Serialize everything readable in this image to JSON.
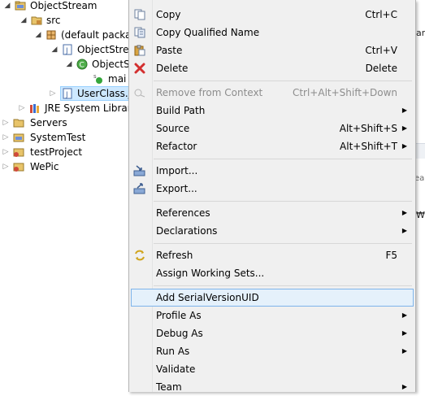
{
  "tree": {
    "nodes": [
      {
        "label": "ObjectStream",
        "icon": "project-icon"
      },
      {
        "label": "src",
        "icon": "source-folder-icon"
      },
      {
        "label": "(default packag",
        "icon": "package-icon"
      },
      {
        "label": "ObjectStrea",
        "icon": "java-file-icon"
      },
      {
        "label": "ObjectS",
        "icon": "class-icon"
      },
      {
        "label": "mai",
        "icon": "method-icon"
      },
      {
        "label": "UserClass.ja",
        "icon": "java-file-icon"
      },
      {
        "label": "JRE System Library",
        "icon": "library-icon"
      },
      {
        "label": "Servers",
        "icon": "folder-icon"
      },
      {
        "label": "SystemTest",
        "icon": "project-icon"
      },
      {
        "label": "testProject",
        "icon": "project-icon"
      },
      {
        "label": "WePic",
        "icon": "project-icon"
      }
    ]
  },
  "background_right": {
    "fragments": [
      "ar",
      "eal",
      "₩"
    ]
  },
  "menu": {
    "items": [
      {
        "label": "Copy",
        "shortcut": "Ctrl+C",
        "icon": "copy-icon"
      },
      {
        "label": "Copy Qualified Name",
        "shortcut": "",
        "icon": "copy-qualified-icon"
      },
      {
        "label": "Paste",
        "shortcut": "Ctrl+V",
        "icon": "paste-icon"
      },
      {
        "label": "Delete",
        "shortcut": "Delete",
        "icon": "delete-icon"
      },
      {
        "label": "Remove from Context",
        "shortcut": "Ctrl+Alt+Shift+Down",
        "icon": "remove-context-icon",
        "disabled": true
      },
      {
        "label": "Build Path",
        "shortcut": "",
        "submenu": true
      },
      {
        "label": "Source",
        "shortcut": "Alt+Shift+S",
        "submenu": true
      },
      {
        "label": "Refactor",
        "shortcut": "Alt+Shift+T",
        "submenu": true
      },
      {
        "label": "Import...",
        "shortcut": "",
        "icon": "import-icon"
      },
      {
        "label": "Export...",
        "shortcut": "",
        "icon": "export-icon"
      },
      {
        "label": "References",
        "shortcut": "",
        "submenu": true
      },
      {
        "label": "Declarations",
        "shortcut": "",
        "submenu": true
      },
      {
        "label": "Refresh",
        "shortcut": "F5",
        "icon": "refresh-icon"
      },
      {
        "label": "Assign Working Sets...",
        "shortcut": ""
      },
      {
        "label": "Add SerialVersionUID",
        "shortcut": "",
        "highlighted": true
      },
      {
        "label": "Profile As",
        "shortcut": "",
        "submenu": true
      },
      {
        "label": "Debug As",
        "shortcut": "",
        "submenu": true
      },
      {
        "label": "Run As",
        "shortcut": "",
        "submenu": true
      },
      {
        "label": "Validate",
        "shortcut": ""
      },
      {
        "label": "Team",
        "shortcut": "",
        "submenu": true
      }
    ],
    "submenu_glyph": "▶"
  }
}
